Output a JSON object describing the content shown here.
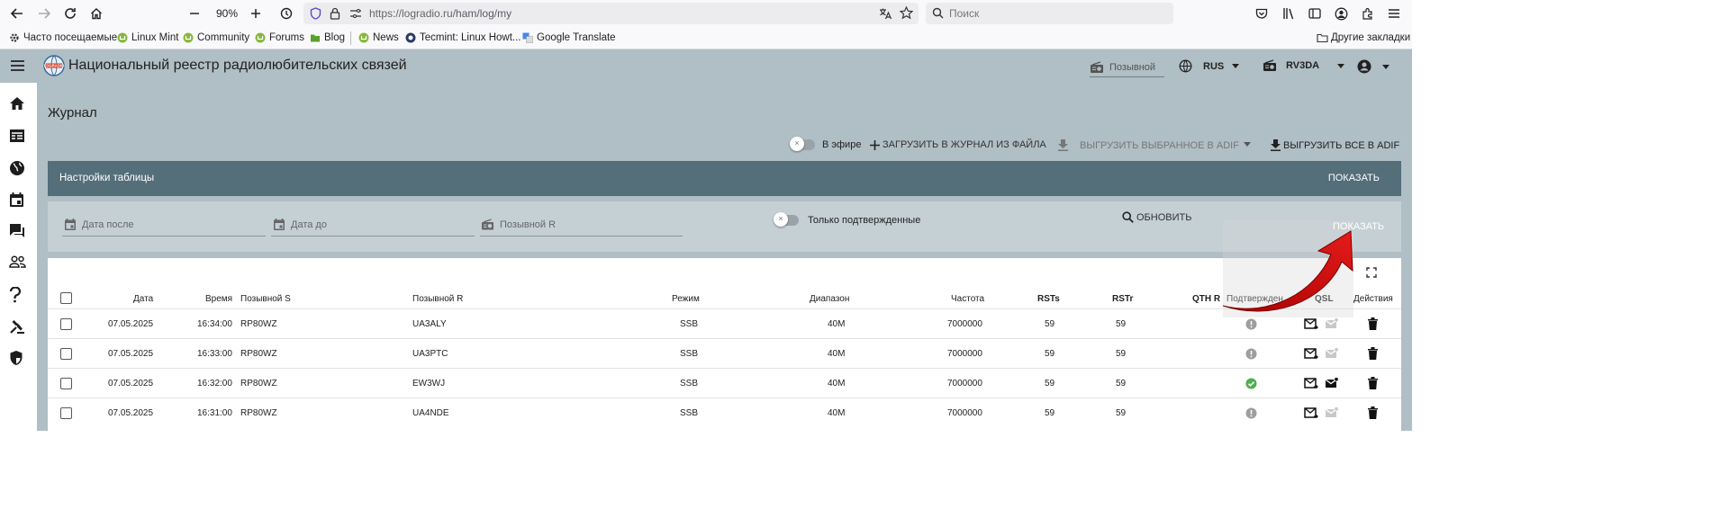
{
  "browser": {
    "zoom": "90%",
    "url_domain": "https://logradio.ru",
    "url_path": "/ham/log/my",
    "search_placeholder": "Поиск"
  },
  "bookmarks": {
    "items": [
      {
        "label": "Часто посещаемые",
        "icon": "gear-icon"
      },
      {
        "label": "Linux Mint",
        "icon": "linux-mint-icon"
      },
      {
        "label": "Community",
        "icon": "linux-mint-icon"
      },
      {
        "label": "Forums",
        "icon": "linux-mint-icon"
      },
      {
        "label": "Blog",
        "icon": "folder-icon"
      },
      {
        "label": "News",
        "icon": "linux-mint-icon"
      },
      {
        "label": "Tecmint: Linux Howt...",
        "icon": "tecmint-icon"
      },
      {
        "label": "Google Translate",
        "icon": "google-translate-icon"
      }
    ],
    "other": "Другие закладки"
  },
  "app": {
    "title": "Национальный реестр радиолюбительских связей",
    "callsign_placeholder": "Позывной",
    "language": "RUS",
    "user_callsign": "RV3DA"
  },
  "page": {
    "title": "Журнал",
    "on_air_label": "В эфире",
    "upload_label": "ЗАГРУЗИТЬ В ЖУРНАЛ ИЗ ФАЙЛА",
    "export_selected_label": "ВЫГРУЗИТЬ ВЫБРАННОЕ В ADIF",
    "export_all_label": "ВЫГРУЗИТЬ ВСЕ В ADIF"
  },
  "settings": {
    "title": "Настройки таблицы",
    "show_label": "ПОКАЗАТЬ"
  },
  "filters": {
    "date_after": "Дата после",
    "date_before": "Дата до",
    "callsign_r": "Позывной R",
    "confirmed_only": "Только подтвержденные",
    "refresh_label": "ОБНОВИТЬ",
    "show_label": "ПОКАЗАТЬ"
  },
  "table": {
    "headers": {
      "date": "Дата",
      "time": "Время",
      "callsign_s": "Позывной S",
      "callsign_r": "Позывной R",
      "mode": "Режим",
      "band": "Диапазон",
      "freq": "Частота",
      "rsts": "RSTs",
      "rstr": "RSTr",
      "qthr": "QTH R",
      "confirmed": "Подтвержден",
      "qsl": "QSL",
      "actions": "Действия"
    },
    "rows": [
      {
        "date": "07.05.2025",
        "time": "16:34:00",
        "callsign_s": "RP80WZ",
        "callsign_r": "UA3ALY",
        "mode": "SSB",
        "band": "40M",
        "freq": "7000000",
        "rsts": "59",
        "rstr": "59",
        "confirmed": false,
        "qsl_received": false
      },
      {
        "date": "07.05.2025",
        "time": "16:33:00",
        "callsign_s": "RP80WZ",
        "callsign_r": "UA3PTC",
        "mode": "SSB",
        "band": "40M",
        "freq": "7000000",
        "rsts": "59",
        "rstr": "59",
        "confirmed": false,
        "qsl_received": false
      },
      {
        "date": "07.05.2025",
        "time": "16:32:00",
        "callsign_s": "RP80WZ",
        "callsign_r": "EW3WJ",
        "mode": "SSB",
        "band": "40M",
        "freq": "7000000",
        "rsts": "59",
        "rstr": "59",
        "confirmed": true,
        "qsl_received": true
      },
      {
        "date": "07.05.2025",
        "time": "16:31:00",
        "callsign_s": "RP80WZ",
        "callsign_r": "UA4NDE",
        "mode": "SSB",
        "band": "40M",
        "freq": "7000000",
        "rsts": "59",
        "rstr": "59",
        "confirmed": false,
        "qsl_received": false
      }
    ]
  },
  "colors": {
    "header_bg": "#b0bec5",
    "settings_bar": "#546e7a",
    "confirmed_green": "#4caf50",
    "annotation_arrow": "#d01010"
  }
}
